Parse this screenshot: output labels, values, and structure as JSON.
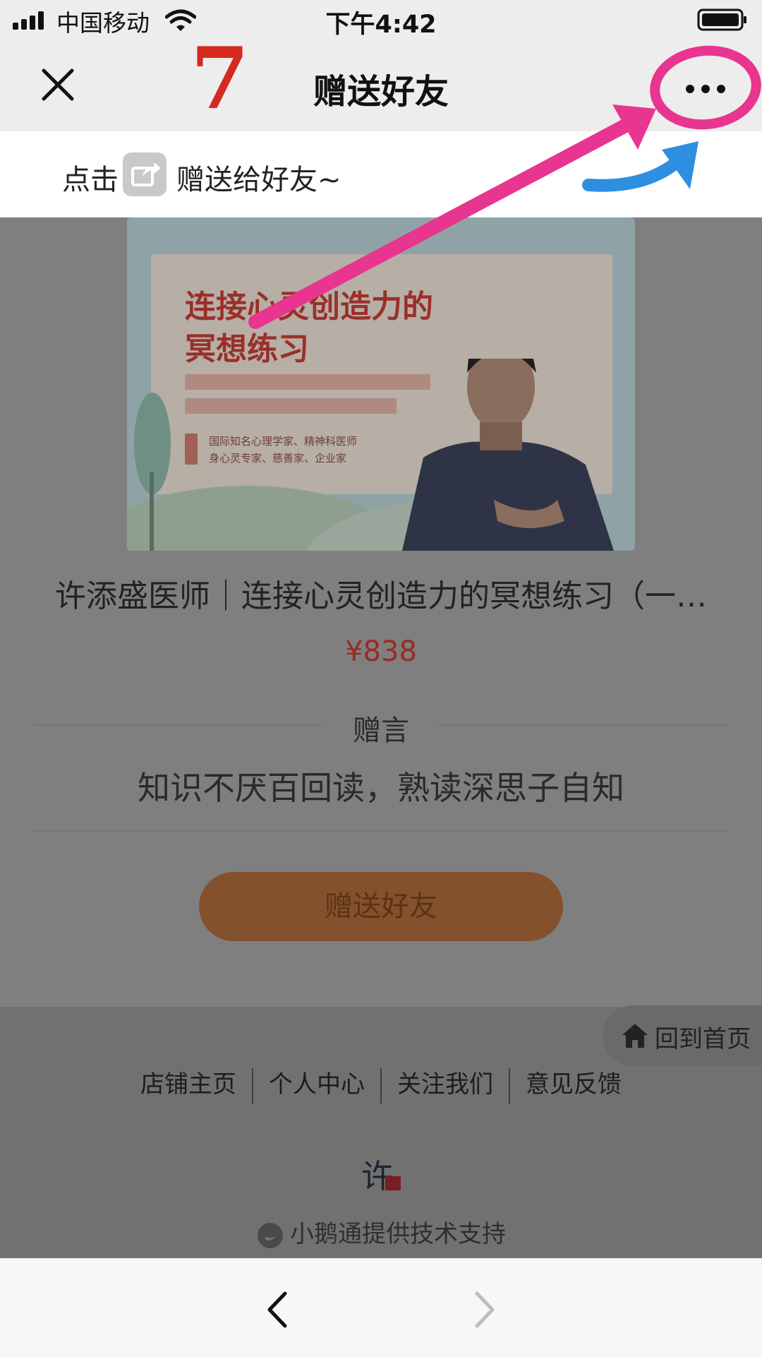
{
  "status_bar": {
    "carrier": "中国移动",
    "time": "下午4:42"
  },
  "nav": {
    "title": "赠送好友",
    "step_number": "7"
  },
  "tip": {
    "prefix": "点击",
    "suffix": "赠送给好友~"
  },
  "banner": {
    "headline_line1": "连接心灵创造力的",
    "headline_line2": "冥想练习",
    "caption_line1": "国际知名心理学家、精神科医师",
    "caption_line2": "身心灵专家、慈善家、企业家"
  },
  "product": {
    "title": "许添盛医师｜连接心灵创造力的冥想练习（一…",
    "price": "¥838"
  },
  "gift": {
    "label": "赠言",
    "message": "知识不厌百回读，熟读深思子自知",
    "button": "赠送好友"
  },
  "home_button": "回到首页",
  "footer_links": [
    "店铺主页",
    "个人中心",
    "关注我们",
    "意见反馈"
  ],
  "footer_logo_text": "许",
  "powered_by": "小鹅通提供技术支持",
  "colors": {
    "step_number": "#d42a20",
    "annotation_pink": "#e8358f",
    "annotation_blue": "#2e8fe0",
    "price": "#9a2a25",
    "button_fill": "#84512d"
  }
}
